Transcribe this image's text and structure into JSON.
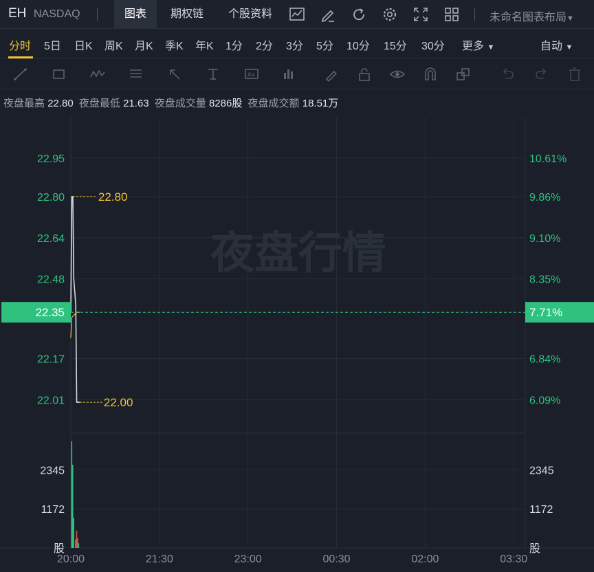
{
  "header": {
    "symbol": "EH",
    "exchange": "NASDAQ",
    "tabs": [
      "图表",
      "期权链",
      "个股资料"
    ],
    "layout_name": "未命名图表布局"
  },
  "periods": [
    "分时",
    "5日",
    "日K",
    "周K",
    "月K",
    "季K",
    "年K",
    "1分",
    "2分",
    "3分",
    "5分",
    "10分",
    "15分",
    "30分",
    "更多"
  ],
  "auto_label": "自动",
  "info": [
    {
      "label": "夜盘最高",
      "value": "22.80"
    },
    {
      "label": "夜盘最低",
      "value": "21.63"
    },
    {
      "label": "夜盘成交量",
      "value": "8286股"
    },
    {
      "label": "夜盘成交额",
      "value": "18.51万"
    }
  ],
  "colors": {
    "up": "#2ec27e",
    "price_tag_bg": "#2ec27e",
    "label_gold": "#f2c230",
    "avg_line": "#e8a33c",
    "price_line": "#d6d9de"
  },
  "chart_data": {
    "type": "line",
    "watermark": "夜盘行情",
    "price_axis": {
      "ticks": [
        22.95,
        22.8,
        22.64,
        22.48,
        22.17,
        22.01
      ],
      "range": [
        21.88,
        23.11
      ]
    },
    "pct_axis": {
      "ticks": [
        "10.61%",
        "9.86%",
        "9.10%",
        "8.35%",
        "6.84%",
        "6.09%"
      ]
    },
    "current": {
      "price": 22.35,
      "pct": "7.71%"
    },
    "high_label": "22.80",
    "low_label": "22.00",
    "x_ticks": [
      "20:00",
      "21:30",
      "23:00",
      "00:30",
      "02:00",
      "03:30"
    ],
    "price_series": [
      {
        "t": "20:00",
        "v": 22.35
      },
      {
        "t": "20:01",
        "v": 22.8
      },
      {
        "t": "20:02",
        "v": 22.8
      },
      {
        "t": "20:03",
        "v": 22.48
      },
      {
        "t": "20:05",
        "v": 22.38
      },
      {
        "t": "20:06",
        "v": 22.0
      },
      {
        "t": "20:09",
        "v": 22.0
      }
    ],
    "avg_series": [
      {
        "t": "20:00",
        "v": 22.25
      },
      {
        "t": "20:01",
        "v": 22.33
      },
      {
        "t": "20:06",
        "v": 22.35
      },
      {
        "t": "20:09",
        "v": 22.35
      }
    ],
    "volume_axis": {
      "ticks": [
        2345,
        1172
      ],
      "unit": "股"
    },
    "volume": [
      {
        "t": "20:00",
        "v": 3200,
        "dir": "up"
      },
      {
        "t": "20:01",
        "v": 2500,
        "dir": "up"
      },
      {
        "t": "20:02",
        "v": 900,
        "dir": "up"
      },
      {
        "t": "20:04",
        "v": 260,
        "dir": "up"
      },
      {
        "t": "20:05",
        "v": 520,
        "dir": "down"
      },
      {
        "t": "20:06",
        "v": 300,
        "dir": "down"
      },
      {
        "t": "20:07",
        "v": 140,
        "dir": "up"
      }
    ]
  }
}
